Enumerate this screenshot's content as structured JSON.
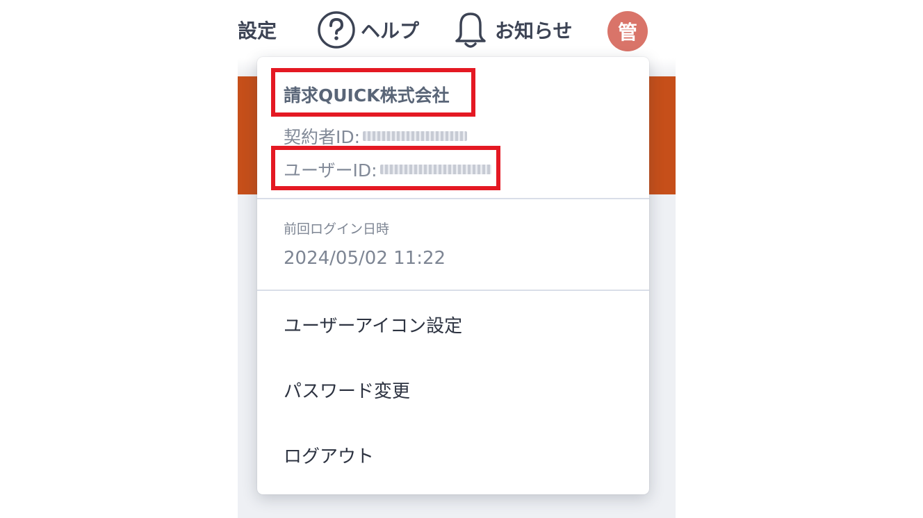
{
  "header": {
    "settings_label": "設定",
    "help_label": "ヘルプ",
    "notifications_label": "お知らせ",
    "avatar_initial": "管"
  },
  "account": {
    "company_name": "請求QUICK株式会社",
    "contract_id_label": "契約者ID:",
    "user_id_label": "ユーザーID:"
  },
  "last_login": {
    "label": "前回ログイン日時",
    "value": "2024/05/02 11:22"
  },
  "menu": {
    "items": [
      {
        "label": "ユーザーアイコン設定"
      },
      {
        "label": "パスワード変更"
      },
      {
        "label": "ログアウト"
      }
    ]
  },
  "colors": {
    "brand_orange": "#c64f1a",
    "avatar_bg": "#d97469",
    "highlight_red": "#e41923",
    "text_dark": "#3c4354",
    "text_muted": "#7d8593"
  }
}
